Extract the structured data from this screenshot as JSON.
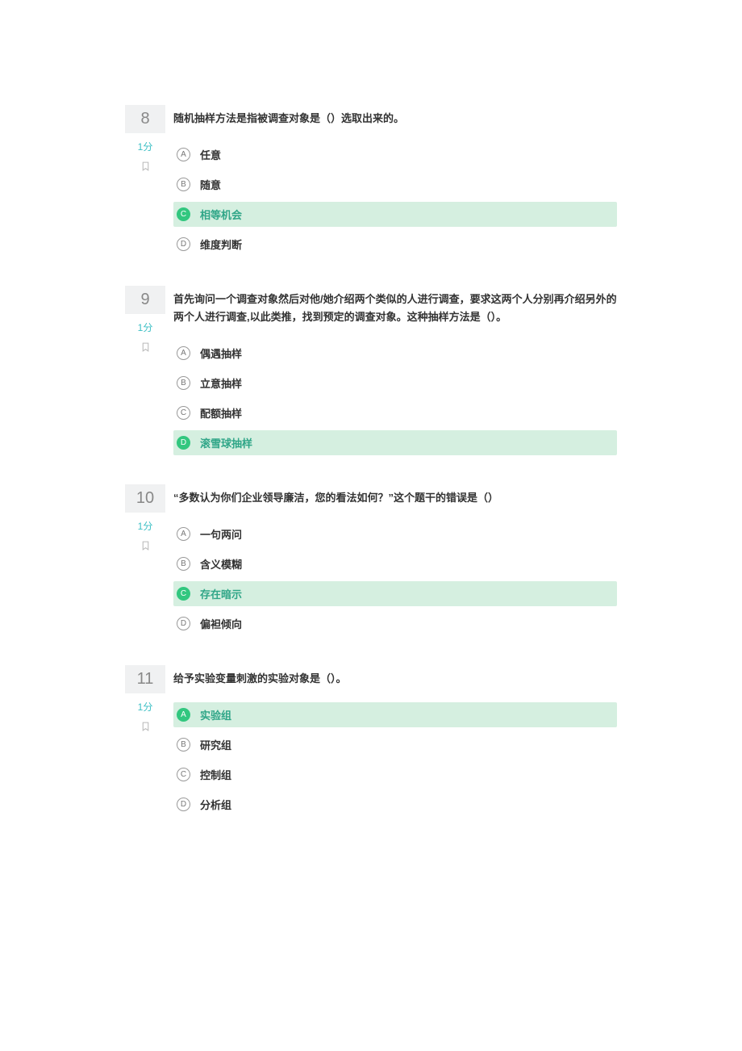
{
  "questions": [
    {
      "number": "8",
      "score": "1分",
      "text": "随机抽样方法是指被调查对象是（）选取出来的。",
      "options": [
        {
          "letter": "A",
          "text": "任意",
          "correct": false
        },
        {
          "letter": "B",
          "text": "随意",
          "correct": false
        },
        {
          "letter": "C",
          "text": "相等机会",
          "correct": true
        },
        {
          "letter": "D",
          "text": "维度判断",
          "correct": false
        }
      ]
    },
    {
      "number": "9",
      "score": "1分",
      "text": "首先询问一个调查对象然后对他/她介绍两个类似的人进行调查，要求这两个人分别再介绍另外的两个人进行调查,以此类推，找到预定的调查对象。这种抽样方法是（）。",
      "options": [
        {
          "letter": "A",
          "text": "偶遇抽样",
          "correct": false
        },
        {
          "letter": "B",
          "text": "立意抽样",
          "correct": false
        },
        {
          "letter": "C",
          "text": "配额抽样",
          "correct": false
        },
        {
          "letter": "D",
          "text": "滚雪球抽样",
          "correct": true
        }
      ]
    },
    {
      "number": "10",
      "score": "1分",
      "text": "“多数认为你们企业领导廉洁，您的看法如何？”这个题干的错误是（）",
      "options": [
        {
          "letter": "A",
          "text": "一句两问",
          "correct": false
        },
        {
          "letter": "B",
          "text": "含义模糊",
          "correct": false
        },
        {
          "letter": "C",
          "text": "存在暗示",
          "correct": true
        },
        {
          "letter": "D",
          "text": "偏袒倾向",
          "correct": false
        }
      ]
    },
    {
      "number": "11",
      "score": "1分",
      "text": "给予实验变量刺激的实验对象是（）。",
      "options": [
        {
          "letter": "A",
          "text": "实验组",
          "correct": true
        },
        {
          "letter": "B",
          "text": "研究组",
          "correct": false
        },
        {
          "letter": "C",
          "text": "控制组",
          "correct": false
        },
        {
          "letter": "D",
          "text": "分析组",
          "correct": false
        }
      ]
    }
  ]
}
